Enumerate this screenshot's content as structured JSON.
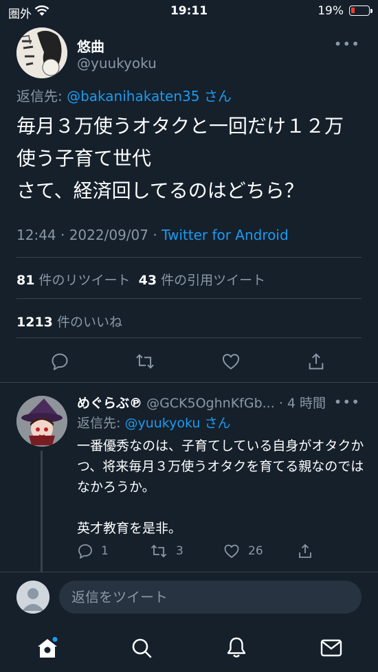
{
  "status_bar": {
    "carrier": "圏外",
    "time": "19:11",
    "battery": "19%"
  },
  "tweet": {
    "author_name": "悠曲",
    "author_handle": "@yuukyoku",
    "reply_to_prefix": "返信先:",
    "reply_to_handle": "@bakanihakaten35",
    "reply_to_suffix": "さん",
    "text": "毎月３万使うオタクと一回だけ１２万\n使う子育て世代\nさて、経済回してるのはどちら？",
    "time": "12:44 · 2022/09/07 ·",
    "source": "Twitter for Android",
    "retweets_count": "81",
    "retweets_label": "件のリツイート",
    "quotes_count": "43",
    "quotes_label": "件の引用ツイート",
    "likes_count": "1213",
    "likes_label": "件のいいね",
    "actions": [
      "reply-icon",
      "retweet-icon",
      "like-icon",
      "share-icon"
    ]
  },
  "reply": {
    "author_name": "めぐらぶ℗",
    "author_handle": "@GCK5OghnKfGb...",
    "age": "· 4 時間",
    "reply_to_prefix": "返信先:",
    "reply_to_handle": "@yuukyoku",
    "reply_to_suffix": "さん",
    "text": "一番優秀なのは、子育てしている自身がオタクかつ、将来毎月３万使うオタクを育てる親なのではなかろうか。\n\n英才教育を是非。",
    "reply_count": "1",
    "retweet_count": "3",
    "like_count": "26"
  },
  "composer": {
    "placeholder": "返信をツイート"
  },
  "tab_bar": [
    "home-icon",
    "search-icon",
    "notifications-icon",
    "messages-icon"
  ],
  "colors": {
    "background": "#15202b",
    "accent": "#1d9bf0",
    "muted": "#8b98a5",
    "divider": "#38444d"
  }
}
